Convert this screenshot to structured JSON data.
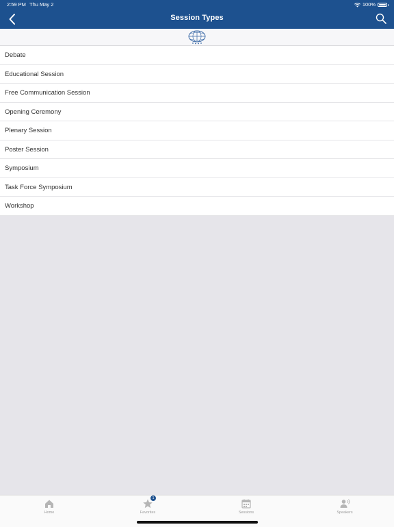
{
  "status_bar": {
    "time": "2:59 PM",
    "date": "Thu May 2",
    "battery": "100%"
  },
  "header": {
    "title": "Session Types",
    "back_icon": "chevron-left-icon",
    "search_icon": "search-icon"
  },
  "logo": {
    "icon": "globe-logo-icon"
  },
  "session_types": [
    "Debate",
    "Educational Session",
    "Free Communication Session",
    "Opening Ceremony",
    "Plenary Session",
    "Poster Session",
    "Symposium",
    "Task Force Symposium",
    "Workshop"
  ],
  "tab_bar": {
    "tabs": [
      {
        "label": "Home",
        "icon": "home-icon"
      },
      {
        "label": "Favorites",
        "icon": "star-icon",
        "badge": "1"
      },
      {
        "label": "Sessions",
        "icon": "calendar-icon"
      },
      {
        "label": "Speakers",
        "icon": "speaker-icon"
      }
    ]
  },
  "colors": {
    "header_bg": "#1d518f",
    "background": "#e6e5ea",
    "tab_label": "#9a9a9a"
  }
}
